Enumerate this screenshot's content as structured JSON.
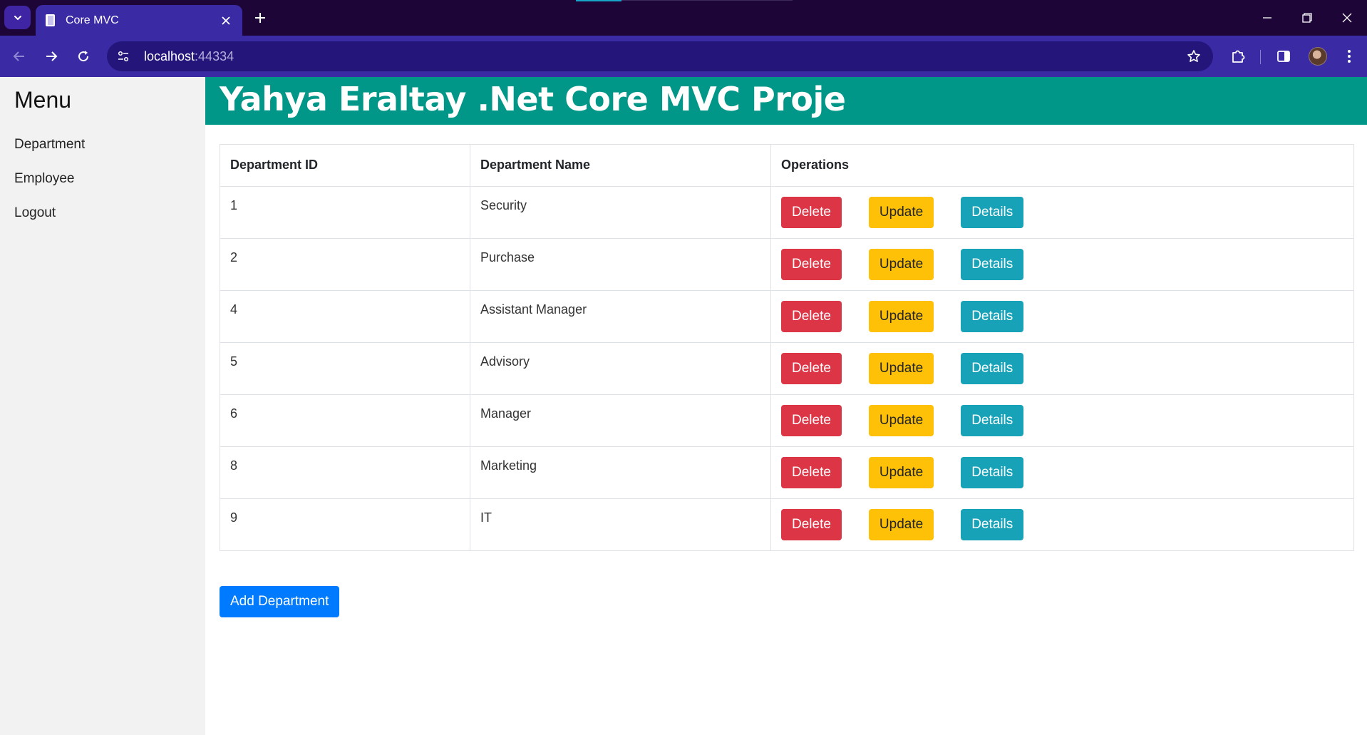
{
  "browser": {
    "tab_title": "Core MVC",
    "url_host": "localhost",
    "url_port": ":44334"
  },
  "sidebar": {
    "title": "Menu",
    "items": [
      {
        "label": "Department"
      },
      {
        "label": "Employee"
      },
      {
        "label": "Logout"
      }
    ]
  },
  "header": {
    "title": "Yahya Eraltay .Net Core MVC Proje"
  },
  "table": {
    "columns": [
      "Department ID",
      "Department Name",
      "Operations"
    ],
    "rows": [
      {
        "id": "1",
        "name": "Security"
      },
      {
        "id": "2",
        "name": "Purchase"
      },
      {
        "id": "4",
        "name": "Assistant Manager"
      },
      {
        "id": "5",
        "name": "Advisory"
      },
      {
        "id": "6",
        "name": "Manager"
      },
      {
        "id": "8",
        "name": "Marketing"
      },
      {
        "id": "9",
        "name": "IT"
      }
    ],
    "actions": {
      "delete": "Delete",
      "update": "Update",
      "details": "Details"
    }
  },
  "add_button": {
    "label": "Add Department"
  },
  "colors": {
    "header": "#009688",
    "delete": "#dc3545",
    "update": "#ffc107",
    "details": "#17a2b8",
    "add": "#007bff",
    "browser_frame": "#3a2aa4",
    "titlebar": "#1e0538"
  },
  "icons": [
    "tab-search-icon",
    "page-favicon-icon",
    "close-tab-icon",
    "new-tab-icon",
    "minimize-icon",
    "restore-icon",
    "close-window-icon",
    "back-icon",
    "forward-icon",
    "reload-icon",
    "site-info-icon",
    "bookmark-star-icon",
    "extensions-icon",
    "side-panel-icon",
    "profile-avatar",
    "more-menu-icon"
  ]
}
